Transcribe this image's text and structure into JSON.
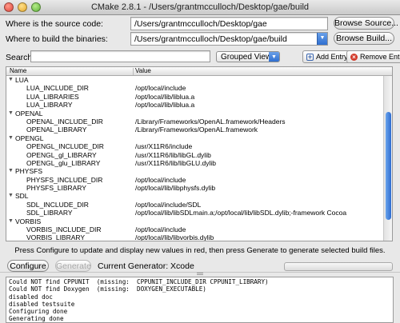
{
  "window": {
    "title": "CMake 2.8.1 - /Users/grantmcculloch/Desktop/gae/build"
  },
  "source": {
    "label": "Where is the source code:",
    "value": "/Users/grantmcculloch/Desktop/gae",
    "browse_label": "Browse Source..."
  },
  "build": {
    "label": "Where to build the binaries:",
    "value": "/Users/grantmcculloch/Desktop/gae/build",
    "browse_label": "Browse Build..."
  },
  "search": {
    "label": "Search:",
    "value": "",
    "view_selected": "Grouped View",
    "add_label": "Add Entry",
    "remove_label": "Remove Entry"
  },
  "tree": {
    "header_name": "Name",
    "header_value": "Value",
    "groups": [
      {
        "name": "LUA",
        "entries": [
          {
            "name": "LUA_INCLUDE_DIR",
            "value": "/opt/local/include"
          },
          {
            "name": "LUA_LIBRARIES",
            "value": "/opt/local/lib/liblua.a"
          },
          {
            "name": "LUA_LIBRARY",
            "value": "/opt/local/lib/liblua.a"
          }
        ]
      },
      {
        "name": "OPENAL",
        "entries": [
          {
            "name": "OPENAL_INCLUDE_DIR",
            "value": "/Library/Frameworks/OpenAL.framework/Headers"
          },
          {
            "name": "OPENAL_LIBRARY",
            "value": "/Library/Frameworks/OpenAL.framework"
          }
        ]
      },
      {
        "name": "OPENGL",
        "entries": [
          {
            "name": "OPENGL_INCLUDE_DIR",
            "value": "/usr/X11R6/include"
          },
          {
            "name": "OPENGL_gl_LIBRARY",
            "value": "/usr/X11R6/lib/libGL.dylib"
          },
          {
            "name": "OPENGL_glu_LIBRARY",
            "value": "/usr/X11R6/lib/libGLU.dylib"
          }
        ]
      },
      {
        "name": "PHYSFS",
        "entries": [
          {
            "name": "PHYSFS_INCLUDE_DIR",
            "value": "/opt/local/include"
          },
          {
            "name": "PHYSFS_LIBRARY",
            "value": "/opt/local/lib/libphysfs.dylib"
          }
        ]
      },
      {
        "name": "SDL",
        "entries": [
          {
            "name": "SDL_INCLUDE_DIR",
            "value": "/opt/local/include/SDL"
          },
          {
            "name": "SDL_LIBRARY",
            "value": "/opt/local/lib/libSDLmain.a;/opt/local/lib/libSDL.dylib;-framework Cocoa"
          }
        ]
      },
      {
        "name": "VORBIS",
        "entries": [
          {
            "name": "VORBIS_INCLUDE_DIR",
            "value": "/opt/local/include"
          },
          {
            "name": "VORBIS_LIBRARY",
            "value": "/opt/local/lib/libvorbis.dylib"
          }
        ]
      }
    ]
  },
  "hint": "Press Configure to update and display new values in red, then press Generate to generate selected build files.",
  "actions": {
    "configure_label": "Configure",
    "generate_label": "Generate",
    "generator_text": "Current Generator: Xcode"
  },
  "log": [
    "Could NOT find CPPUNIT  (missing:  CPPUNIT_INCLUDE_DIR CPPUNIT_LIBRARY)",
    "Could NOT find Doxygen  (missing:  DOXYGEN_EXECUTABLE)",
    "disabled doc",
    "disabled testsuite",
    "Configuring done",
    "Generating done"
  ],
  "icons": {
    "expand": "disclosure-triangle-down",
    "add": "plus-icon",
    "remove": "x-icon"
  }
}
